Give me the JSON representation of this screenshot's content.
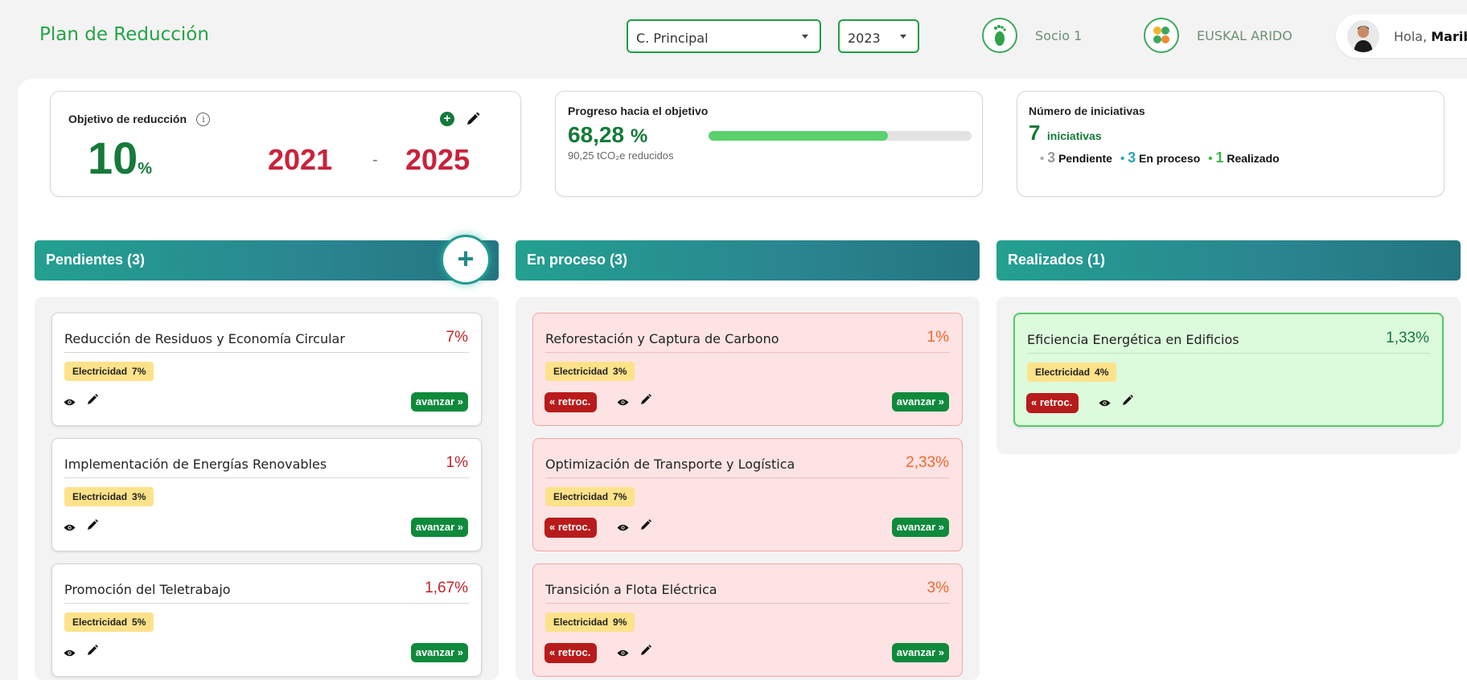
{
  "header": {
    "title": "Plan de Reducción",
    "center_select": "C. Principal",
    "year_select": "2023",
    "partner1": {
      "icon": "footprint-icon",
      "label": "Socio 1"
    },
    "partner2": {
      "icon": "company-logo",
      "label": "EUSKAL ARIDO"
    },
    "user": {
      "greeting": "Hola, ",
      "name": "Maribe"
    }
  },
  "objective": {
    "label": "Objetivo de reducción",
    "value": "10",
    "unit": "%",
    "start_year": "2021",
    "separator": "-",
    "end_year": "2025"
  },
  "progress": {
    "label": "Progreso hacia el objetivo",
    "value": "68,28",
    "unit": "%",
    "fraction": 0.6828,
    "subtitle": "90,25 tCO₂e reducidos"
  },
  "initiatives_summary": {
    "label": "Número de iniciativas",
    "total": "7",
    "total_label": "iniciativas",
    "pending_count": "3",
    "pending_label": "Pendiente",
    "process_count": "3",
    "process_label": "En proceso",
    "done_count": "1",
    "done_label": "Realizado"
  },
  "columns": {
    "pending": {
      "title": "Pendientes (3)",
      "items": [
        {
          "name": "Reducción de Residuos y Economía Circular",
          "pct": "7%",
          "tag": "Electricidad",
          "tag_val": "7%",
          "advance": "avanzar"
        },
        {
          "name": "Implementación de Energías Renovables",
          "pct": "1%",
          "tag": "Electricidad",
          "tag_val": "3%",
          "advance": "avanzar"
        },
        {
          "name": "Promoción del Teletrabajo",
          "pct": "1,67%",
          "tag": "Electricidad",
          "tag_val": "5%",
          "advance": "avanzar"
        }
      ]
    },
    "process": {
      "title": "En proceso (3)",
      "items": [
        {
          "name": "Reforestación y Captura de Carbono",
          "pct": "1%",
          "tag": "Electricidad",
          "tag_val": "3%",
          "back": "retroc.",
          "advance": "avanzar"
        },
        {
          "name": "Optimización de Transporte y Logística",
          "pct": "2,33%",
          "tag": "Electricidad",
          "tag_val": "7%",
          "back": "retroc.",
          "advance": "avanzar"
        },
        {
          "name": "Transición a Flota Eléctrica",
          "pct": "3%",
          "tag": "Electricidad",
          "tag_val": "9%",
          "back": "retroc.",
          "advance": "avanzar"
        }
      ]
    },
    "done": {
      "title": "Realizados (1)",
      "items": [
        {
          "name": "Eficiencia Energética en Edificios",
          "pct": "1,33%",
          "tag": "Electricidad",
          "tag_val": "4%",
          "back": "retroc."
        }
      ]
    }
  },
  "colors": {
    "brand_green": "#23a447",
    "dark_green": "#157a3a",
    "year_red": "#c8233a",
    "pending_pct": "#c0232a",
    "process_pct": "#f0672b",
    "done_pct": "#157a3a",
    "header_teal": "#23a090",
    "tag_yellow": "#fde28a",
    "advance_green": "#0f8a3c",
    "back_red": "#b81b1b"
  }
}
